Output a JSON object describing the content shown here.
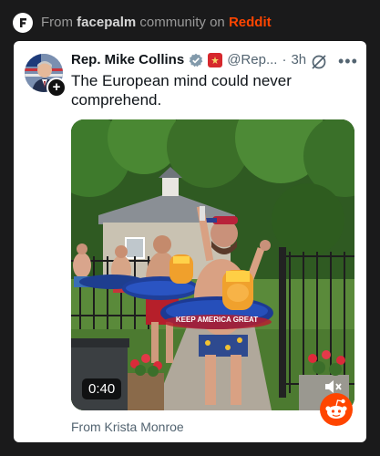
{
  "header": {
    "prefix": "From ",
    "community": "facepalm",
    "middle": " community on ",
    "platform": "Reddit"
  },
  "post": {
    "author_name": "Rep. Mike Collins",
    "handle": "@Rep...",
    "separator": "·",
    "time": "3h",
    "text": "The European mind could never comprehend.",
    "video_duration": "0:40",
    "credit": "From Krista Monroe",
    "float_text": "KEEP AMERICA GREAT"
  },
  "icons": {
    "logo": "f-logo-icon",
    "verified": "verified-badge-icon",
    "flag": "flag-icon",
    "grok": "grok-icon",
    "more": "more-options-icon",
    "mute": "muted-speaker-icon",
    "snoo": "reddit-snoo-icon"
  },
  "colors": {
    "background": "#1a1a1b",
    "card": "#ffffff",
    "reddit": "#ff4500",
    "verified": "#829aab"
  }
}
